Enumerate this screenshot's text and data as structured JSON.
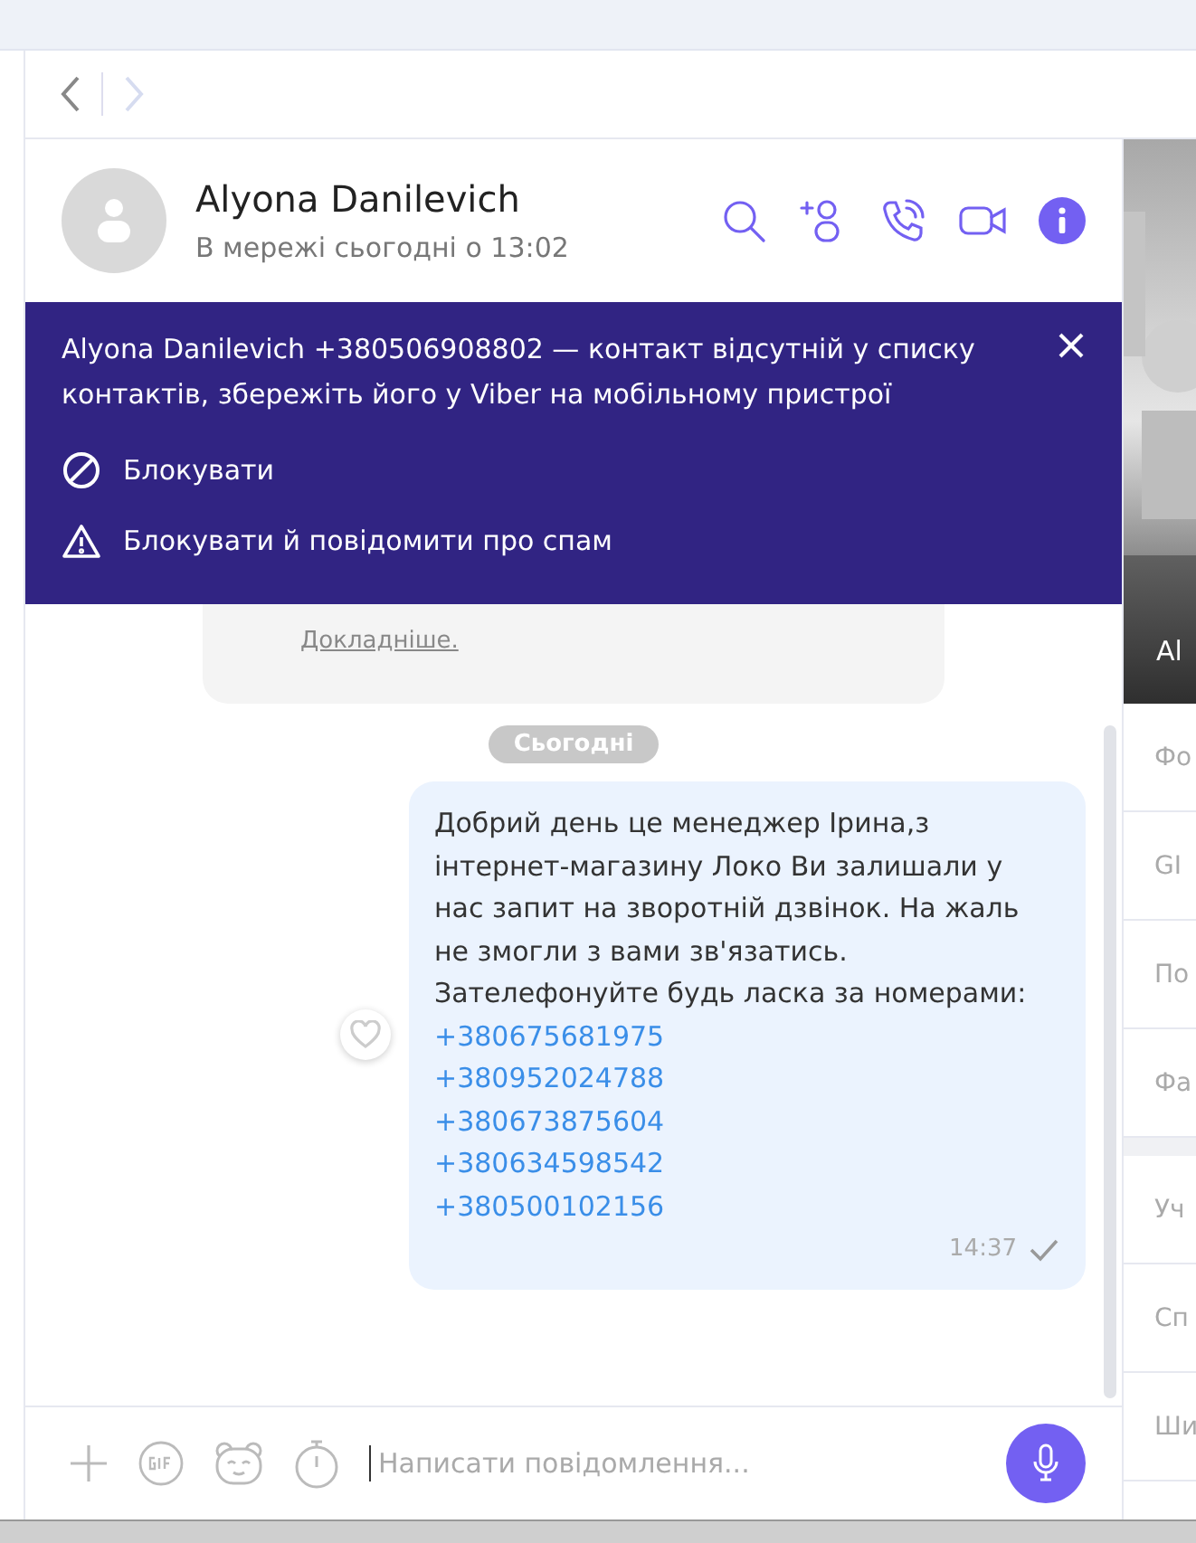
{
  "nav": {
    "back_disabled": false,
    "forward_disabled": true
  },
  "chat_header": {
    "name": "Alyona Danilevich",
    "status": "В мережі сьогодні о 13:02"
  },
  "banner": {
    "message": "Alyona Danilevich +380506908802 — контакт відсутній у списку контактів, збережіть його у Viber на мобільному пристрої",
    "actions": [
      {
        "kind": "block",
        "label": "Блокувати"
      },
      {
        "kind": "spam",
        "label": "Блокувати й повідомити про спам"
      }
    ]
  },
  "notice": {
    "link": "Докладніше."
  },
  "date_separator": "Сьогодні",
  "message": {
    "lines": [
      "Добрий день це менеджер Ірина,з інтернет-магазину Локо Ви залишали у нас запит на зворотній дзвінок. На жаль не змогли з вами зв'язатись.",
      "Зателефонуйте будь ласка за номерами:"
    ],
    "links": [
      "+380675681975",
      "+380952024788",
      "+380673875604",
      "+380634598542",
      "+380500102156"
    ],
    "time": "14:37",
    "delivered": true,
    "liked": false
  },
  "composer": {
    "placeholder": "Написати повідомлення..."
  },
  "side_panel": {
    "photo_caption": "Al",
    "items": [
      "Фо",
      "GI",
      "По",
      "Фа"
    ],
    "items_2": [
      "Уч",
      "Сп",
      "Ши"
    ]
  }
}
